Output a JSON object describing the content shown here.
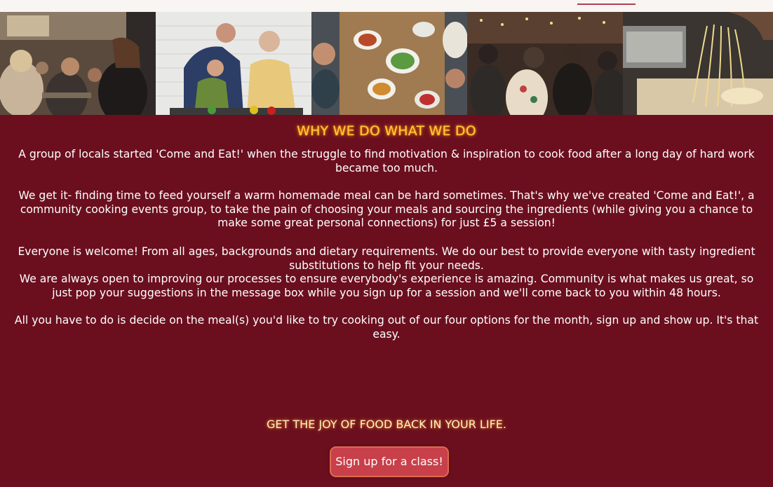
{
  "topbar": {
    "active_accent": "#b04050"
  },
  "gallery": {
    "photos": [
      {
        "icon": "restaurant-crowd-photo"
      },
      {
        "icon": "family-cooking-photo"
      },
      {
        "icon": "table-feast-photo"
      },
      {
        "icon": "crowd-event-photo"
      },
      {
        "icon": "pasta-making-photo"
      }
    ]
  },
  "about": {
    "heading": "WHY WE DO WHAT WE DO",
    "paragraph_1": "A group of locals started 'Come and Eat!' when the struggle to find motivation & inspiration to cook food after a long day of hard work became too much.",
    "paragraph_2": "We get it- finding time to feed yourself a warm homemade meal can be hard sometimes. That's why we've created 'Come and Eat!', a community cooking events group, to take the pain of choosing your meals and sourcing the ingredients (while giving you a chance to make some great personal connections) for just £5 a session!",
    "paragraph_3a": "Everyone is welcome! From all ages, backgrounds and dietary requirements. We do our best to provide everyone with tasty ingredient substitutions to help fit your needs.",
    "paragraph_3b": "We are always open to improving our processes to ensure everybody's experience is amazing. Community is what makes us great, so just pop your suggestions in the message box while you sign up for a session and we'll come back to you within 48 hours.",
    "paragraph_4": "All you have to do is decide on the meal(s) you'd like to try cooking out of our four options for the month, sign up and show up. It's that easy."
  },
  "cta": {
    "tagline": "GET THE JOY OF FOOD BACK IN YOUR LIFE.",
    "button_label": "Sign up for a class!"
  },
  "colors": {
    "background": "#6b0f1f",
    "heading": "#ffcc3a",
    "button": "#c8404a"
  }
}
